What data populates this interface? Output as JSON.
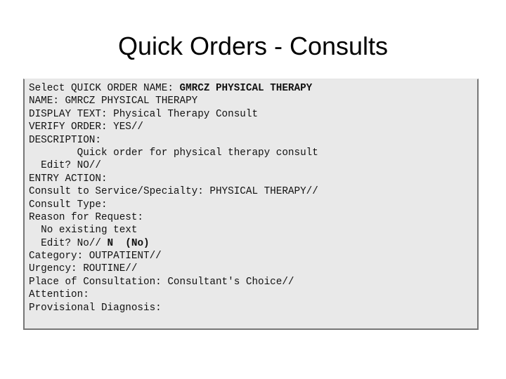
{
  "slide": {
    "title": "Quick Orders - Consults",
    "background_color": "#ffffff",
    "title_color": "#000000"
  },
  "terminal": {
    "background_color": "#e9e9e9",
    "border_color": "#777777",
    "text_color": "#111111",
    "lines": [
      {
        "text": "Select QUICK ORDER NAME: ",
        "bold_text": "GMRCZ PHYSICAL THERAPY"
      },
      {
        "text": "NAME: GMRCZ PHYSICAL THERAPY",
        "bold_text": ""
      },
      {
        "text": "DISPLAY TEXT: Physical Therapy Consult",
        "bold_text": ""
      },
      {
        "text": "VERIFY ORDER: YES//",
        "bold_text": ""
      },
      {
        "text": "DESCRIPTION:",
        "bold_text": ""
      },
      {
        "text": "        Quick order for physical therapy consult",
        "bold_text": ""
      },
      {
        "text": "  Edit? NO//",
        "bold_text": ""
      },
      {
        "text": "ENTRY ACTION:",
        "bold_text": ""
      },
      {
        "text": "Consult to Service/Specialty: PHYSICAL THERAPY//",
        "bold_text": ""
      },
      {
        "text": "Consult Type:",
        "bold_text": ""
      },
      {
        "text": "Reason for Request:",
        "bold_text": ""
      },
      {
        "text": "  No existing text",
        "bold_text": ""
      },
      {
        "text": "  Edit? No// ",
        "bold_text": "N  (No)"
      },
      {
        "text": "Category: OUTPATIENT//",
        "bold_text": ""
      },
      {
        "text": "Urgency: ROUTINE//",
        "bold_text": ""
      },
      {
        "text": "Place of Consultation: Consultant's Choice//",
        "bold_text": ""
      },
      {
        "text": "Attention:",
        "bold_text": ""
      },
      {
        "text": "Provisional Diagnosis:",
        "bold_text": ""
      }
    ]
  }
}
